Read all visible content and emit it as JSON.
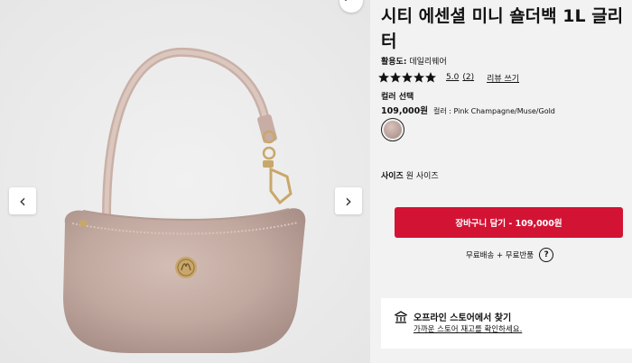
{
  "product": {
    "title": "시티 에센셜 미니 숄더백 1L 글리터",
    "activity_label": "활용도:",
    "activity_value": "데일리웨어",
    "rating": 5,
    "rating_text": "5.0",
    "rating_count": "(2)",
    "review_link": "리뷰 쓰기",
    "color_heading": "컬러 선택",
    "price": "109,000원",
    "color_text": "컬러 : Pink Champagne/Muse/Gold",
    "size_label": "사이즈",
    "size_value": "원 사이즈"
  },
  "actions": {
    "add_to_cart": "장바구니 담기 - 109,000원",
    "shipping_info": "무료배송 + 무료반품",
    "help_glyph": "?"
  },
  "store": {
    "title": "오프라인 스토어에서 찾기",
    "subtitle": "가까운 스토어 재고를 확인하세요."
  },
  "gallery": {
    "prev_glyph": "‹",
    "next_glyph": "›"
  },
  "colors": {
    "cart_button": "#d31334",
    "background": "#f2f2f2"
  }
}
